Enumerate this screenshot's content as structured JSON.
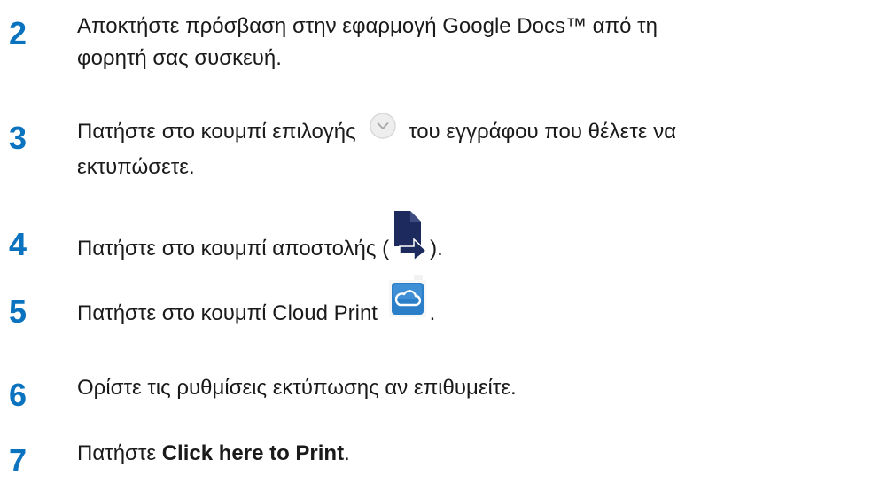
{
  "steps": [
    {
      "number": "2",
      "line1": "Αποκτήστε πρόσβαση στην εφαρμογή Google Docs™ από τη",
      "line2": "φορητή σας συσκευή."
    },
    {
      "number": "3",
      "before": "Πατήστε στο κουμπί επιλογής",
      "after": "του εγγράφου που θέλετε να",
      "line2": "εκτυπώσετε.",
      "icon": "chevron-down-circle-icon"
    },
    {
      "number": "4",
      "before": "Πατήστε στο κουμπί αποστολής (",
      "after": ").",
      "icon": "send-document-icon"
    },
    {
      "number": "5",
      "before": "Πατήστε στο κουμπί Cloud Print",
      "after": ".",
      "icon": "cloud-print-icon"
    },
    {
      "number": "6",
      "line1": "Ορίστε τις ρυθμίσεις εκτύπωσης αν επιθυμείτε."
    },
    {
      "number": "7",
      "before": "Πατήστε",
      "bold": "Click here to Print",
      "after": "."
    }
  ],
  "colors": {
    "step_number": "#0a73bf",
    "send_icon": "#1c2a5e",
    "cloud_icon": "#2a7fc8"
  }
}
